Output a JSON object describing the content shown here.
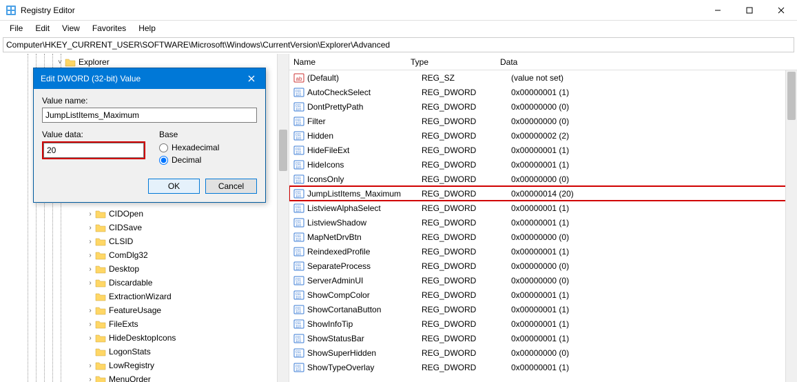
{
  "window": {
    "title": "Registry Editor"
  },
  "menu": [
    "File",
    "Edit",
    "View",
    "Favorites",
    "Help"
  ],
  "address": "Computer\\HKEY_CURRENT_USER\\SOFTWARE\\Microsoft\\Windows\\CurrentVersion\\Explorer\\Advanced",
  "tree": {
    "root": {
      "label": "Explorer",
      "expander": "˅"
    },
    "children": [
      {
        "label": "CIDOpen",
        "expander": "›"
      },
      {
        "label": "CIDSave",
        "expander": "›"
      },
      {
        "label": "CLSID",
        "expander": "›"
      },
      {
        "label": "ComDlg32",
        "expander": "›"
      },
      {
        "label": "Desktop",
        "expander": "›"
      },
      {
        "label": "Discardable",
        "expander": "›"
      },
      {
        "label": "ExtractionWizard",
        "expander": ""
      },
      {
        "label": "FeatureUsage",
        "expander": "›"
      },
      {
        "label": "FileExts",
        "expander": "›"
      },
      {
        "label": "HideDesktopIcons",
        "expander": "›"
      },
      {
        "label": "LogonStats",
        "expander": ""
      },
      {
        "label": "LowRegistry",
        "expander": "›"
      },
      {
        "label": "MenuOrder",
        "expander": "›"
      }
    ]
  },
  "columns": {
    "name": "Name",
    "type": "Type",
    "data": "Data"
  },
  "values": [
    {
      "icon": "sz",
      "name": "(Default)",
      "type": "REG_SZ",
      "data": "(value not set)"
    },
    {
      "icon": "dw",
      "name": "AutoCheckSelect",
      "type": "REG_DWORD",
      "data": "0x00000001 (1)"
    },
    {
      "icon": "dw",
      "name": "DontPrettyPath",
      "type": "REG_DWORD",
      "data": "0x00000000 (0)"
    },
    {
      "icon": "dw",
      "name": "Filter",
      "type": "REG_DWORD",
      "data": "0x00000000 (0)"
    },
    {
      "icon": "dw",
      "name": "Hidden",
      "type": "REG_DWORD",
      "data": "0x00000002 (2)"
    },
    {
      "icon": "dw",
      "name": "HideFileExt",
      "type": "REG_DWORD",
      "data": "0x00000001 (1)"
    },
    {
      "icon": "dw",
      "name": "HideIcons",
      "type": "REG_DWORD",
      "data": "0x00000001 (1)"
    },
    {
      "icon": "dw",
      "name": "IconsOnly",
      "type": "REG_DWORD",
      "data": "0x00000000 (0)"
    },
    {
      "icon": "dw",
      "name": "JumpListItems_Maximum",
      "type": "REG_DWORD",
      "data": "0x00000014 (20)",
      "highlight": true
    },
    {
      "icon": "dw",
      "name": "ListviewAlphaSelect",
      "type": "REG_DWORD",
      "data": "0x00000001 (1)"
    },
    {
      "icon": "dw",
      "name": "ListviewShadow",
      "type": "REG_DWORD",
      "data": "0x00000001 (1)"
    },
    {
      "icon": "dw",
      "name": "MapNetDrvBtn",
      "type": "REG_DWORD",
      "data": "0x00000000 (0)"
    },
    {
      "icon": "dw",
      "name": "ReindexedProfile",
      "type": "REG_DWORD",
      "data": "0x00000001 (1)"
    },
    {
      "icon": "dw",
      "name": "SeparateProcess",
      "type": "REG_DWORD",
      "data": "0x00000000 (0)"
    },
    {
      "icon": "dw",
      "name": "ServerAdminUI",
      "type": "REG_DWORD",
      "data": "0x00000000 (0)"
    },
    {
      "icon": "dw",
      "name": "ShowCompColor",
      "type": "REG_DWORD",
      "data": "0x00000001 (1)"
    },
    {
      "icon": "dw",
      "name": "ShowCortanaButton",
      "type": "REG_DWORD",
      "data": "0x00000001 (1)"
    },
    {
      "icon": "dw",
      "name": "ShowInfoTip",
      "type": "REG_DWORD",
      "data": "0x00000001 (1)"
    },
    {
      "icon": "dw",
      "name": "ShowStatusBar",
      "type": "REG_DWORD",
      "data": "0x00000001 (1)"
    },
    {
      "icon": "dw",
      "name": "ShowSuperHidden",
      "type": "REG_DWORD",
      "data": "0x00000000 (0)"
    },
    {
      "icon": "dw",
      "name": "ShowTypeOverlay",
      "type": "REG_DWORD",
      "data": "0x00000001 (1)"
    }
  ],
  "dialog": {
    "title": "Edit DWORD (32-bit) Value",
    "value_name_label": "Value name:",
    "value_name": "JumpListItems_Maximum",
    "value_data_label": "Value data:",
    "value_data": "20",
    "base_label": "Base",
    "hex_label": "Hexadecimal",
    "dec_label": "Decimal",
    "base_selected": "decimal",
    "ok": "OK",
    "cancel": "Cancel"
  }
}
